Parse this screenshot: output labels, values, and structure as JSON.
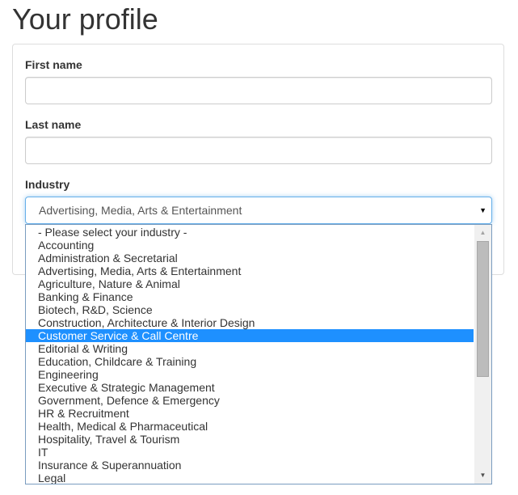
{
  "page": {
    "title": "Your profile"
  },
  "form": {
    "first_name": {
      "label": "First name",
      "value": "",
      "placeholder": ""
    },
    "last_name": {
      "label": "Last name",
      "value": "",
      "placeholder": ""
    },
    "industry": {
      "label": "Industry",
      "selected_value": "Advertising, Media, Arts & Entertainment",
      "highlighted_option": "Customer Service & Call Centre",
      "options": [
        "- Please select your industry -",
        "Accounting",
        "Administration & Secretarial",
        "Advertising, Media, Arts & Entertainment",
        "Agriculture, Nature & Animal",
        "Banking & Finance",
        "Biotech, R&D, Science",
        "Construction, Architecture & Interior Design",
        "Customer Service & Call Centre",
        "Editorial & Writing",
        "Education, Childcare & Training",
        "Engineering",
        "Executive & Strategic Management",
        "Government, Defence & Emergency",
        "HR & Recruitment",
        "Health, Medical & Pharmaceutical",
        "Hospitality, Travel & Tourism",
        "IT",
        "Insurance & Superannuation",
        "Legal"
      ]
    }
  },
  "icons": {
    "dropdown_arrow": "▼",
    "scroll_up": "▲",
    "scroll_down": "▼"
  },
  "colors": {
    "highlight": "#1e90ff",
    "focus_border": "#66afe9",
    "text": "#333333"
  }
}
